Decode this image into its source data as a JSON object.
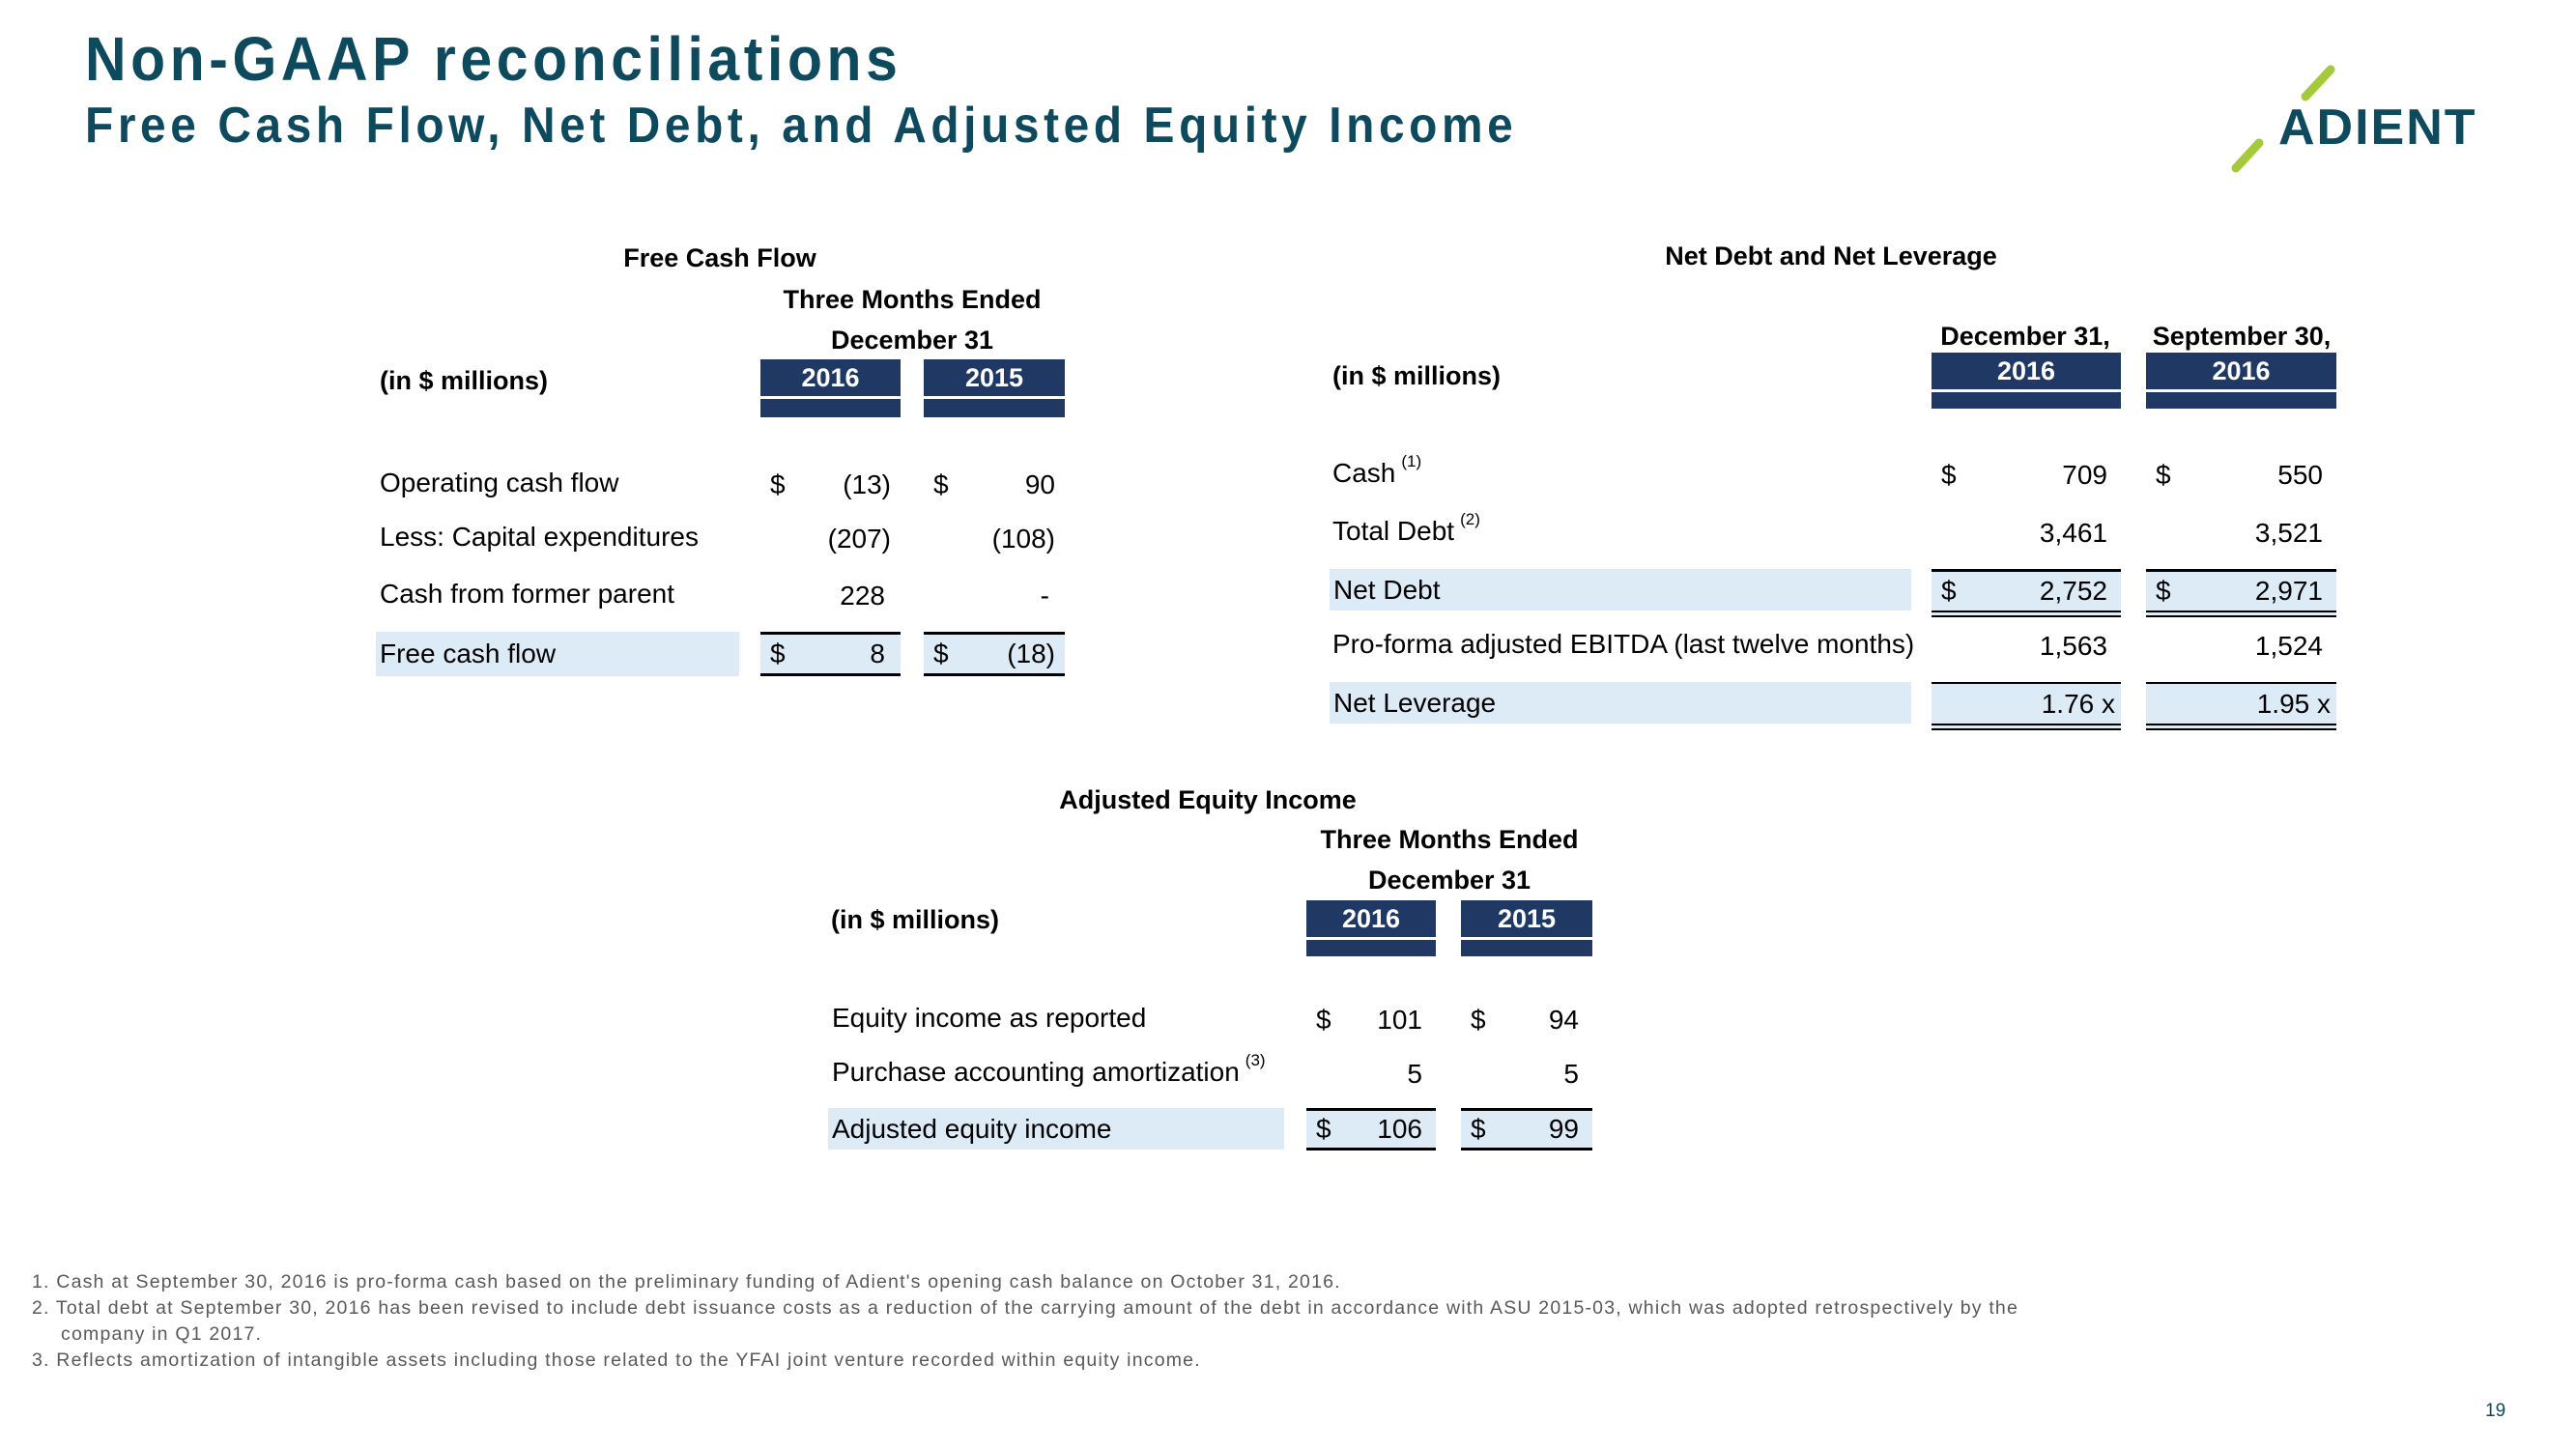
{
  "header": {
    "title": "Non-GAAP reconciliations",
    "subtitle": "Free Cash Flow, Net Debt, and Adjusted Equity Income",
    "logo_text": "ADIENT",
    "brand_colors": {
      "navy": "#0e4a5e",
      "lime": "#a4c93a",
      "header_fill": "#1f3864",
      "row_shade": "#ddebf7"
    }
  },
  "free_cash_flow": {
    "title": "Free Cash Flow",
    "period_line1": "Three Months Ended",
    "period_line2": "December 31",
    "units": "(in $ millions)",
    "columns": [
      "2016",
      "2015"
    ],
    "rows": [
      {
        "label": "Operating cash flow",
        "values": [
          {
            "dollar": "$",
            "num": "(13)"
          },
          {
            "dollar": "$",
            "num": "90"
          }
        ]
      },
      {
        "label": "Less: Capital expenditures",
        "values": [
          {
            "dollar": "",
            "num": "(207)"
          },
          {
            "dollar": "",
            "num": "(108)"
          }
        ]
      },
      {
        "label": "Cash from former parent",
        "values": [
          {
            "dollar": "",
            "num": "228"
          },
          {
            "dollar": "",
            "num": "-"
          }
        ]
      },
      {
        "label": "Free cash flow",
        "values": [
          {
            "dollar": "$",
            "num": "8"
          },
          {
            "dollar": "$",
            "num": "(18)"
          }
        ]
      }
    ]
  },
  "net_debt": {
    "title": "Net Debt and Net Leverage",
    "units": "(in $ millions)",
    "columns": [
      {
        "date": "December 31,",
        "year": "2016"
      },
      {
        "date": "September 30,",
        "year": "2016"
      }
    ],
    "rows": [
      {
        "label": "Cash",
        "note": "(1)",
        "values": [
          {
            "dollar": "$",
            "num": "709"
          },
          {
            "dollar": "$",
            "num": "550"
          }
        ]
      },
      {
        "label": "Total Debt",
        "note": "(2)",
        "values": [
          {
            "dollar": "",
            "num": "3,461"
          },
          {
            "dollar": "",
            "num": "3,521"
          }
        ]
      },
      {
        "label": "Net Debt",
        "note": "",
        "values": [
          {
            "dollar": "$",
            "num": "2,752"
          },
          {
            "dollar": "$",
            "num": "2,971"
          }
        ]
      },
      {
        "label": "Pro-forma adjusted EBITDA (last twelve months)",
        "note": "",
        "values": [
          {
            "dollar": "",
            "num": "1,563"
          },
          {
            "dollar": "",
            "num": "1,524"
          }
        ]
      },
      {
        "label": "Net Leverage",
        "note": "",
        "values": [
          {
            "dollar": "",
            "num": "1.76 x"
          },
          {
            "dollar": "",
            "num": "1.95 x"
          }
        ]
      }
    ]
  },
  "adjusted_equity_income": {
    "title": "Adjusted Equity Income",
    "period_line1": "Three Months Ended",
    "period_line2": "December 31",
    "units": "(in $ millions)",
    "columns": [
      "2016",
      "2015"
    ],
    "rows": [
      {
        "label": "Equity income as reported",
        "note": "",
        "values": [
          {
            "dollar": "$",
            "num": "101"
          },
          {
            "dollar": "$",
            "num": "94"
          }
        ]
      },
      {
        "label": "Purchase accounting amortization",
        "note": "(3)",
        "values": [
          {
            "dollar": "",
            "num": "5"
          },
          {
            "dollar": "",
            "num": "5"
          }
        ]
      },
      {
        "label": "Adjusted equity income",
        "note": "",
        "values": [
          {
            "dollar": "$",
            "num": "106"
          },
          {
            "dollar": "$",
            "num": "99"
          }
        ]
      }
    ]
  },
  "footnotes": [
    "1. Cash at September 30, 2016 is pro-forma cash based on the preliminary funding of Adient's opening cash balance on October 31, 2016.",
    "2. Total debt at September 30, 2016 has been revised to include debt issuance costs as a reduction of the carrying amount of the debt in accordance with ASU 2015-03, which was adopted retrospectively by the",
    "company in Q1 2017.",
    "3. Reflects amortization of intangible assets including those related to the YFAI joint venture recorded within equity income."
  ],
  "page_number": "19"
}
